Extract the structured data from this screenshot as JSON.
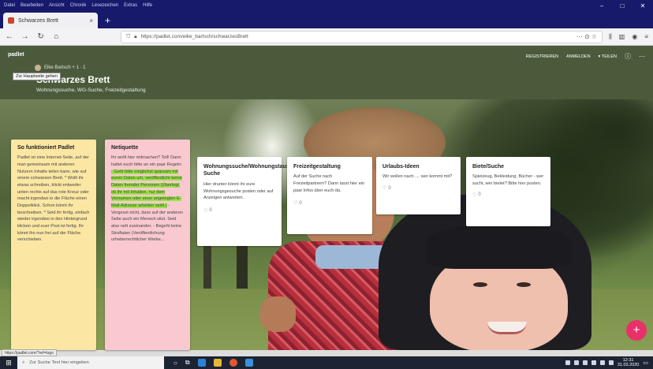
{
  "browser": {
    "menu": [
      "Datei",
      "Bearbeiten",
      "Ansicht",
      "Chronik",
      "Lesezeichen",
      "Extras",
      "Hilfe"
    ],
    "tab_title": "Schwarzes Brett",
    "url": "https://padlet.com/elke_bartsch/schwarzesBrett",
    "zoom_icon": "⋯ ⊙ ☆"
  },
  "padlet": {
    "logo": "padlet",
    "author": "Elke Bartsch + 1 · 1",
    "tooltip": "Zur Hauptseite gehen",
    "title": "Schwarzes Brett",
    "subtitle": "Wohnungssuche, WG-Suche, Freizeitgestaltung",
    "actions": {
      "register": "REGISTRIEREN",
      "login": "ANMELDEN",
      "share": "▾ TEILEN",
      "info": "ⓘ",
      "more": "⋯"
    }
  },
  "cards": [
    {
      "title": "So funktioniert Padlet",
      "body": "Padlet ist eine Internet-Seite, auf der man gemeinsam mit anderen Nutzern Inhalte teilen kann, wie auf einem schwarzen Brett. * Wollt ihr etwas schreiben, klickt entweder unten rechts auf das rote Kreuz oder macht irgendwo in die Fläche einen Doppelklick. Schon könnt ihr beschreiben. * Seid ihr fertig, einfach wieder irgendwo in den Hintergrund klicken und euer Post ist fertig. Ihr könnt ihn nun frei auf der Fläche verschieben."
    },
    {
      "title": "Netiquette",
      "body_plain_1": "Ihr wollt hier mitmachen? Toll! Dann haltet euch bitte an ein paar Regeln: ",
      "body_highlight": "- Geht bitte möglichst sparsam mit euren Daten um, veröffentlicht keine Daten fremder Personen (Überlegt, ob ihr mit Inhalten, nur dem Vornamen oder einer angelegten E-Mail-Adresse arbeiten wollt.)",
      "body_plain_2": " - Vergesst nicht, dass auf der anderen Seite auch ein Mensch sitzt. Seid also nett zueinander. - Begeht keine Straftaten (Veröffentlichung urheberrechtlicher Werke..."
    },
    {
      "title": "Wohnungssuche/Wohnungstausch/WG-Suche",
      "body": "Hier drunter könnt ihr eure Wohnungsgesuche posten oder auf Anzeigen antworten.",
      "comments": "0"
    },
    {
      "title": "Freizeitgestaltung",
      "body": "Auf der Suche nach Freizeitpartnern? Dann lasst hier ein paar Infos über euch da.",
      "comments": "0"
    },
    {
      "title": "Urlaubs-Ideen",
      "body": "Wir wollen nach .... wer kommt mit?",
      "comments": "0"
    },
    {
      "title": "Biete/Suche",
      "body": "Spielzeug, Bekleidung, Bücher - wer sucht, wer bietet? Bitte hier posten.",
      "comments": "0"
    }
  ],
  "status_url": "https://padlet.com/?ref=logo",
  "fab_label": "+",
  "taskbar": {
    "search_placeholder": "Zur Suche Text hier eingeben",
    "time": "12:31",
    "date": "31.03.2020"
  },
  "colors": {
    "header": "#4c5a3c",
    "card_yellow": "#fbe7a3",
    "card_pink": "#f9c9cf",
    "card_white": "#ffffff",
    "highlight": "#9be24a",
    "fab": "#e8316a",
    "titlebar": "#17196a"
  }
}
